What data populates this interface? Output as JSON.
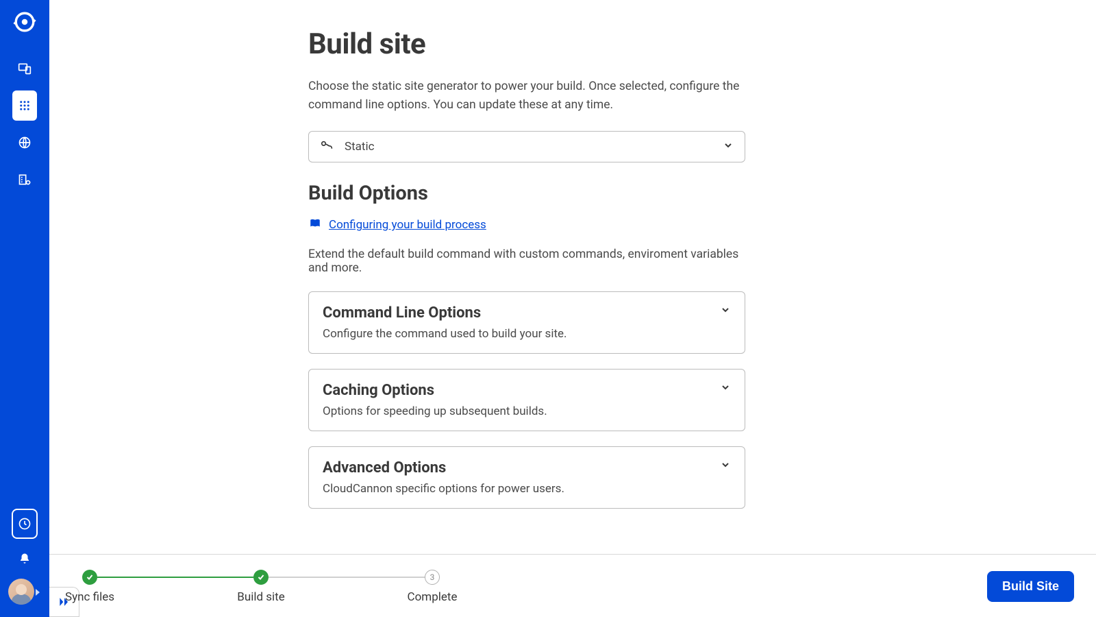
{
  "page": {
    "title": "Build site",
    "description": "Choose the static site generator to power your build. Once selected, configure the command line options. You can update these at any time."
  },
  "ssg_select": {
    "value": "Static"
  },
  "build_options": {
    "heading": "Build Options",
    "doc_link": "Configuring your build process",
    "description": "Extend the default build command with custom commands, enviroment variables and more.",
    "sections": [
      {
        "title": "Command Line Options",
        "desc": "Configure the command used to build your site."
      },
      {
        "title": "Caching Options",
        "desc": "Options for speeding up subsequent builds."
      },
      {
        "title": "Advanced Options",
        "desc": "CloudCannon specific options for power users."
      }
    ]
  },
  "stepper": {
    "steps": [
      {
        "label": "Sync files",
        "state": "done"
      },
      {
        "label": "Build site",
        "state": "done"
      },
      {
        "label": "Complete",
        "state": "todo",
        "num": "3"
      }
    ]
  },
  "actions": {
    "build_site": "Build Site"
  }
}
